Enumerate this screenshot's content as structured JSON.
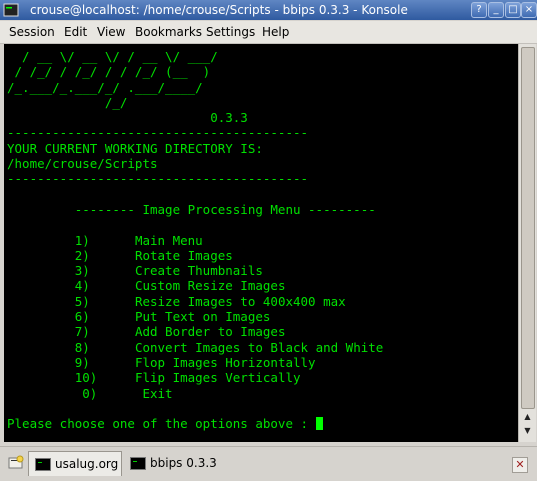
{
  "window": {
    "title": "crouse@localhost: /home/crouse/Scripts - bbips 0.3.3 - Konsole",
    "buttons": {
      "help": "?",
      "minimize": "_",
      "maximize": "□",
      "close": "×"
    }
  },
  "menubar": {
    "items": [
      "Session",
      "Edit",
      "View",
      "Bookmarks",
      "Settings",
      "Help"
    ]
  },
  "terminal": {
    "art": [
      "  / __ \\/ __ \\/ / __ \\/ ___/",
      " / /_/ / /_/ / / /_/ (__  )",
      "/_.___/_.___/_/ .___/____/",
      "             /_/"
    ],
    "version": "0.3.3",
    "separator": "----------------------------------------",
    "cwd_label": "YOUR CURRENT WORKING DIRECTORY IS:",
    "cwd": "/home/crouse/Scripts",
    "menu_title": "-------- Image Processing Menu ---------",
    "options": [
      {
        "key": "1)",
        "label": "Main Menu"
      },
      {
        "key": "2)",
        "label": "Rotate Images"
      },
      {
        "key": "3)",
        "label": "Create Thumbnails"
      },
      {
        "key": "4)",
        "label": "Custom Resize Images"
      },
      {
        "key": "5)",
        "label": "Resize Images to 400x400 max"
      },
      {
        "key": "6)",
        "label": "Put Text on Images"
      },
      {
        "key": "7)",
        "label": "Add Border to Images"
      },
      {
        "key": "8)",
        "label": "Convert Images to Black and White"
      },
      {
        "key": "9)",
        "label": "Flop Images Horizontally"
      },
      {
        "key": "10)",
        "label": "Flip Images Vertically"
      },
      {
        "key": "0)",
        "label": "Exit"
      }
    ],
    "prompt": "Please choose one of the options above : "
  },
  "tabs": {
    "items": [
      {
        "label": "usalug.org"
      },
      {
        "label": "bbips 0.3.3"
      }
    ]
  },
  "colors": {
    "terminal_fg": "#00e000",
    "terminal_bg": "#000000",
    "titlebar": "#3f6bb2"
  }
}
